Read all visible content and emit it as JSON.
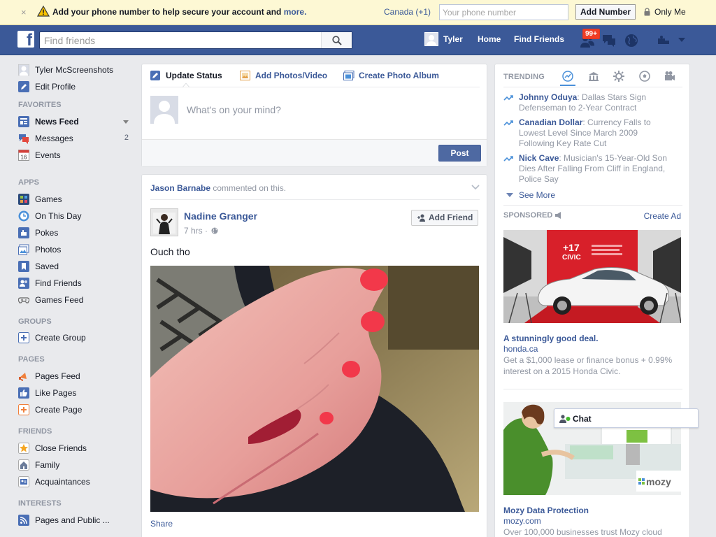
{
  "banner": {
    "close": "×",
    "message": "Add your phone number to help secure your account and",
    "more": "more.",
    "country": "Canada (+1)",
    "phone_placeholder": "Your phone number",
    "add_button": "Add Number",
    "privacy": "Only Me"
  },
  "topbar": {
    "logo": "f",
    "search_placeholder": "Find friends",
    "user": "Tyler",
    "home": "Home",
    "find_friends": "Find Friends",
    "notif_badge": "99+"
  },
  "leftnav": {
    "profile_name": "Tyler McScreenshots",
    "edit_profile": "Edit Profile",
    "favorites_head": "FAVORITES",
    "news_feed": "News Feed",
    "messages": "Messages",
    "messages_count": "2",
    "events": "Events",
    "events_day": "16",
    "apps_head": "APPS",
    "games": "Games",
    "on_this_day": "On This Day",
    "pokes": "Pokes",
    "photos": "Photos",
    "saved": "Saved",
    "find_friends": "Find Friends",
    "games_feed": "Games Feed",
    "groups_head": "GROUPS",
    "create_group": "Create Group",
    "pages_head": "PAGES",
    "pages_feed": "Pages Feed",
    "like_pages": "Like Pages",
    "create_page": "Create Page",
    "friends_head": "FRIENDS",
    "close_friends": "Close Friends",
    "family": "Family",
    "acquaintances": "Acquaintances",
    "interests_head": "INTERESTS",
    "pages_public": "Pages and Public ..."
  },
  "composer": {
    "tab_status": "Update Status",
    "tab_photos": "Add Photos/Video",
    "tab_album": "Create Photo Album",
    "placeholder": "What's on your mind?",
    "post": "Post"
  },
  "story": {
    "actor": "Jason Barnabe",
    "action": " commented on this.",
    "author": "Nadine Granger",
    "time": "7 hrs ·",
    "add_friend": "Add Friend",
    "text": "Ouch tho",
    "share": "Share"
  },
  "trending": {
    "title": "TRENDING",
    "items": [
      {
        "topic": "Johnny Oduya",
        "desc": ": Dallas Stars Sign Defenseman to 2-Year Contract"
      },
      {
        "topic": "Canadian Dollar",
        "desc": ": Currency Falls to Lowest Level Since March 2009 Following Key Rate Cut"
      },
      {
        "topic": "Nick Cave",
        "desc": ": Musician's 15-Year-Old Son Dies After Falling From Cliff in England, Police Say"
      }
    ],
    "see_more": "See More"
  },
  "sponsored": {
    "title": "SPONSORED",
    "create_ad": "Create Ad",
    "ad1": {
      "banner_num": "+17",
      "banner_brand": "CIVIC",
      "title": "A stunningly good deal.",
      "domain": "honda.ca",
      "body": "Get a $1,000 lease or finance bonus + 0.99% interest on a 2015 Honda Civic."
    },
    "ad2": {
      "logo": "mozy",
      "title": "Mozy Data Protection",
      "domain": "mozy.com",
      "body": "Over 100,000 businesses trust Mozy cloud"
    }
  },
  "chat": {
    "label": "Chat"
  }
}
